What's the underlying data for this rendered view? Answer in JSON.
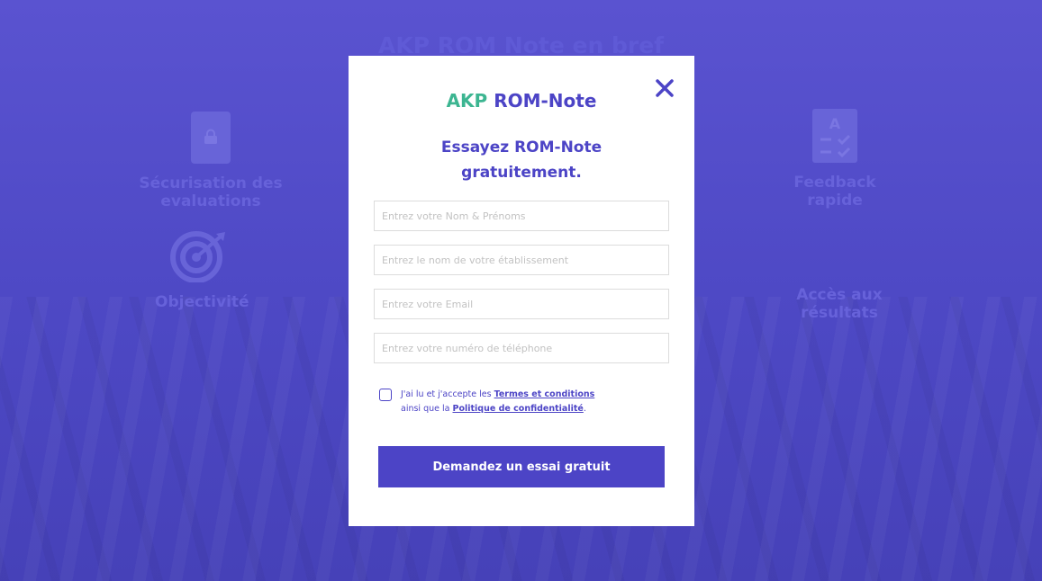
{
  "background": {
    "section_title": "AKP ROM Note en bref",
    "features": [
      {
        "label": "Sécurisation des evaluations",
        "icon": "lock-icon"
      },
      {
        "label": "Feedback rapide",
        "icon": "checklist-icon"
      },
      {
        "label": "Objectivité",
        "icon": "target-icon"
      },
      {
        "label": "Accès aux résultats",
        "icon": ""
      }
    ]
  },
  "modal": {
    "brand_accent": "AKP",
    "brand_name": "ROM-Note",
    "headline_line1": "Essayez ROM-Note",
    "headline_line2": "gratuitement.",
    "close_icon": "close-icon",
    "fields": {
      "name_placeholder": "Entrez votre Nom & Prénoms",
      "school_placeholder": "Entrez le nom de votre établissement",
      "email_placeholder": "Entrez votre Email",
      "phone_placeholder": "Entrez votre numéro de téléphone"
    },
    "consent": {
      "prefix": "J'ai lu et j'accepte les ",
      "terms_link": "Termes et conditions",
      "middle": "ainsi que la ",
      "privacy_link": "Politique de confidentialité",
      "suffix": "."
    },
    "submit_label": "Demandez un essai gratuit"
  },
  "colors": {
    "brand_purple": "#4c44c6",
    "brand_green": "#3cb591",
    "overlay_bg": "#4f4bc8"
  }
}
